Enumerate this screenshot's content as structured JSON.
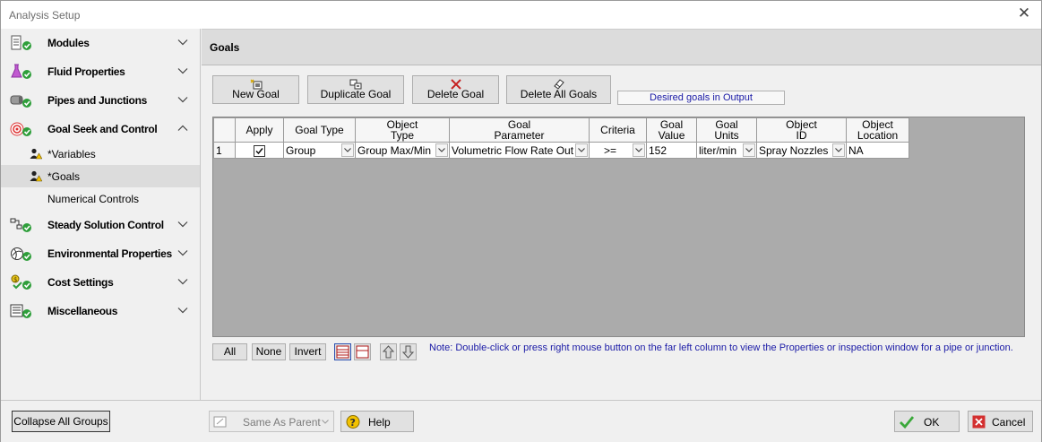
{
  "window": {
    "title": "Analysis Setup"
  },
  "sidebar": {
    "groups": [
      {
        "label": "Modules",
        "icon": "modules-icon",
        "expanded": false
      },
      {
        "label": "Fluid Properties",
        "icon": "flask-icon",
        "expanded": false
      },
      {
        "label": "Pipes and Junctions",
        "icon": "pipe-icon",
        "expanded": false
      },
      {
        "label": "Goal Seek and Control",
        "icon": "target-icon",
        "expanded": true
      },
      {
        "label": "Steady Solution Control",
        "icon": "solution-icon",
        "expanded": false
      },
      {
        "label": "Environmental Properties",
        "icon": "globe-icon",
        "expanded": false
      },
      {
        "label": "Cost Settings",
        "icon": "cost-icon",
        "expanded": false
      },
      {
        "label": "Miscellaneous",
        "icon": "misc-icon",
        "expanded": false
      }
    ],
    "subitems": [
      {
        "label": "*Variables"
      },
      {
        "label": "*Goals"
      },
      {
        "label": "Numerical Controls"
      }
    ],
    "collapse_label": "Collapse All Groups"
  },
  "main": {
    "title": "Goals",
    "toolbar": {
      "new_goal": "New Goal",
      "duplicate_goal": "Duplicate Goal",
      "delete_goal": "Delete Goal",
      "delete_all_goals": "Delete All Goals"
    },
    "desired_goals": "Desired goals in Output",
    "table": {
      "headers": {
        "apply": "Apply",
        "goal_type": "Goal Type",
        "object_type_1": "Object",
        "object_type_2": "Type",
        "goal_param_1": "Goal",
        "goal_param_2": "Parameter",
        "criteria": "Criteria",
        "goal_value_1": "Goal",
        "goal_value_2": "Value",
        "goal_units_1": "Goal",
        "goal_units_2": "Units",
        "object_id_1": "Object",
        "object_id_2": "ID",
        "object_loc_1": "Object",
        "object_loc_2": "Location"
      },
      "rows": [
        {
          "num": "1",
          "apply": true,
          "goal_type": "Group",
          "object_type": "Group Max/Min",
          "goal_parameter": "Volumetric Flow Rate Out",
          "criteria": ">=",
          "goal_value": "152",
          "goal_units": "liter/min",
          "object_id": "Spray Nozzles",
          "object_location": "NA"
        }
      ]
    },
    "select_buttons": {
      "all": "All",
      "none": "None",
      "invert": "Invert"
    },
    "note": "Note: Double-click or press right mouse button on the far left column to view the Properties or inspection window for a pipe or junction."
  },
  "footer": {
    "same_as_parent": "Same As Parent",
    "help": "Help",
    "ok": "OK",
    "cancel": "Cancel"
  },
  "colors": {
    "accent_blue": "#1a1aa6",
    "grid_background": "#ababab",
    "ok_check": "#3aa83a",
    "cancel_red": "#d32f2f"
  }
}
